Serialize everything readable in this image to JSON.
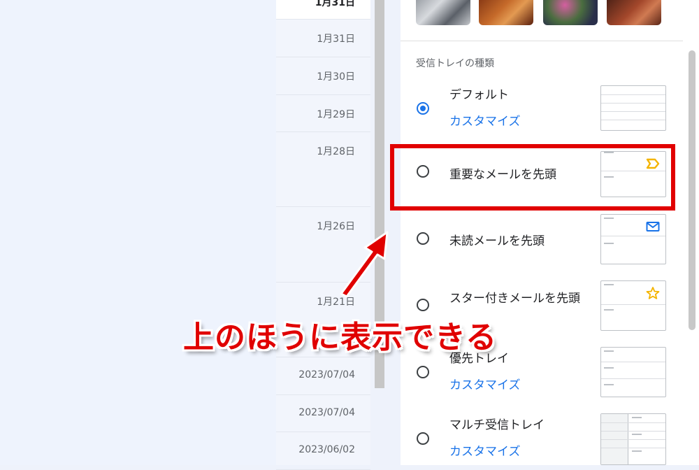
{
  "mail_list": {
    "rows": [
      {
        "date": "1月31日",
        "unread": true
      },
      {
        "date": "1月31日"
      },
      {
        "date": "1月30日"
      },
      {
        "date": "1月29日"
      },
      {
        "date": "1月28日"
      },
      {
        "date": "1月26日"
      },
      {
        "date": "1月21日"
      },
      {
        "date": "2023/07/04"
      },
      {
        "date": "2023/07/04"
      },
      {
        "date": "2023/06/02"
      }
    ]
  },
  "settings": {
    "section_title": "受信トレイの種類",
    "options": [
      {
        "label": "デフォルト",
        "customize": "カスタマイズ",
        "selected": true,
        "preview_icon": "none"
      },
      {
        "label": "重要なメールを先頭",
        "selected": false,
        "preview_icon": "important-marker-icon"
      },
      {
        "label": "未読メールを先頭",
        "selected": false,
        "preview_icon": "mail-icon"
      },
      {
        "label": "スター付きメールを先頭",
        "selected": false,
        "preview_icon": "star-icon"
      },
      {
        "label": "優先トレイ",
        "customize": "カスタマイズ",
        "selected": false,
        "preview_icon": "none"
      },
      {
        "label": "マルチ受信トレイ",
        "customize": "カスタマイズ",
        "selected": false,
        "preview_icon": "none"
      }
    ]
  },
  "annotation": {
    "text": "上のほうに表示できる",
    "color": "#e00000"
  },
  "colors": {
    "accent": "#1a73e8",
    "important": "#f4b400",
    "highlight": "#e10000"
  }
}
